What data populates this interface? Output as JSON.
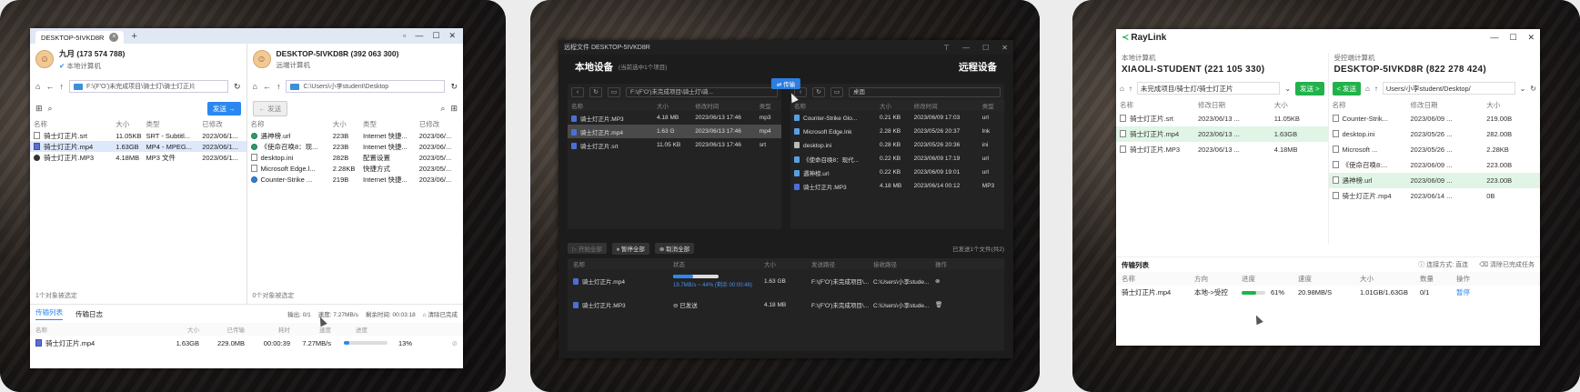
{
  "device1": {
    "tab_title": "DESKTOP-5IVKD8R",
    "tab_close": "×",
    "tab_add": "+",
    "local": {
      "name": "九月 (173 574 788)",
      "sub": "本地计算机",
      "path": "F:\\(F'O')未完成项目\\骑士灯\\骑士灯正片",
      "send_label": "发送",
      "columns": [
        "名称",
        "大小",
        "类型",
        "已修改"
      ],
      "rows": [
        [
          "骑士灯正片.srt",
          "11.05KB",
          "SRT - Subtitl...",
          "2023/06/1..."
        ],
        [
          "骑士灯正片.mp4",
          "1.63GB",
          "MP4 - MPEG...",
          "2023/06/1..."
        ],
        [
          "骑士灯正片.MP3",
          "4.18MB",
          "MP3 文件",
          "2023/06/1..."
        ]
      ],
      "selected_count": "1个对象被选定"
    },
    "remote": {
      "name": "DESKTOP-5IVKD8R (392 063 300)",
      "sub": "远端计算机",
      "path": "C:\\Users\\小李student\\Desktop",
      "send_label": "发送",
      "columns": [
        "名称",
        "大小",
        "类型",
        "已修改"
      ],
      "rows": [
        [
          "遇神榜.url",
          "223B",
          "Internet 快捷...",
          "2023/06/..."
        ],
        [
          "《使命召唤8：现...",
          "223B",
          "Internet 快捷...",
          "2023/06/..."
        ],
        [
          "desktop.ini",
          "282B",
          "配置设置",
          "2023/05/..."
        ],
        [
          "Microsoft Edge.l...",
          "2.28KB",
          "快捷方式",
          "2023/05/..."
        ],
        [
          "Counter-Strike ...",
          "219B",
          "Internet 快捷...",
          "2023/06/..."
        ]
      ],
      "selected_count": "0个对象被选定"
    },
    "transfer": {
      "tab_list": "传输列表",
      "tab_log": "传输日志",
      "stat_inout": "输出: 0/1",
      "stat_speed": "速度: 7.27MB/s",
      "stat_left": "剩余时间: 00:03:18",
      "clear_label": "清除已完成",
      "columns": [
        "名称",
        "大小",
        "已传输",
        "耗时",
        "速度",
        "进度"
      ],
      "row": {
        "name": "骑士灯正片.mp4",
        "size": "1.63GB",
        "done": "229.0MB",
        "time": "00:00:39",
        "speed": "7.27MB/s",
        "progress_text": "13%",
        "progress": 0.13
      }
    }
  },
  "device2": {
    "title": "远程文件 DESKTOP-5IVKD8R",
    "local_label": "本地设备",
    "local_hint": "(当前选中1个项目)",
    "remote_label": "远程设备",
    "local_path": "F:\\(F'O')未完成项目\\骑士灯\\骑...",
    "remote_path": "桌面",
    "send_label": "⇄ 传输",
    "local_columns": [
      "名称",
      "大小",
      "修改时间",
      "类型"
    ],
    "local_rows": [
      [
        "骑士灯正片.MP3",
        "4.18 MB",
        "2023/06/13 17:46",
        "mp3"
      ],
      [
        "骑士灯正片.mp4",
        "1.63 G",
        "2023/06/13 17:46",
        "mp4"
      ],
      [
        "骑士灯正片.srt",
        "11.05 KB",
        "2023/06/13 17:46",
        "srt"
      ]
    ],
    "remote_columns": [
      "名称",
      "大小",
      "修改时间",
      "类型"
    ],
    "remote_rows": [
      [
        "Counter-Strike Glo...",
        "0.21 KB",
        "2023/06/09 17:03",
        "url"
      ],
      [
        "Microsoft Edge.lnk",
        "2.28 KB",
        "2023/05/26 20:37",
        "lnk"
      ],
      [
        "desktop.ini",
        "0.28 KB",
        "2023/05/26 20:36",
        "ini"
      ],
      [
        "《使命召唤8：现代...",
        "0.22 KB",
        "2023/06/09 17:19",
        "url"
      ],
      [
        "遇神榜.url",
        "0.22 KB",
        "2023/06/09 19:01",
        "url"
      ],
      [
        "骑士灯正片.MP3",
        "4.18 MB",
        "2023/06/14 00:12",
        "MP3"
      ]
    ],
    "btn_start_all": "开始全部",
    "btn_pause_all": "暂停全部",
    "btn_cancel_all": "取消全部",
    "done_count": "已发送1个文件(共2)",
    "xfer_columns": [
      "名称",
      "状态",
      "大小",
      "发送路径",
      "接收路径",
      "操作"
    ],
    "xfer_rows": [
      {
        "name": "骑士灯正片.mp4",
        "status": "19.7MB/s ~ 44% (剩余 00:00:48)",
        "progress": 0.44,
        "size": "1.63 GB",
        "src": "F:\\(F'O')未完成项目\\...",
        "dst": "C:\\Users\\小李stude..."
      },
      {
        "name": "骑士灯正片.MP3",
        "status": "已发送",
        "progress": 1,
        "size": "4.18 MB",
        "src": "F:\\(F'O')未完成项目\\...",
        "dst": "C:\\Users\\小李stude..."
      }
    ]
  },
  "device3": {
    "logo": "RayLink",
    "local_label": "本地计算机",
    "local_name": "XIAOLI-STUDENT (221 105 330)",
    "remote_label": "受控端计算机",
    "remote_name": "DESKTOP-5IVKD8R (822 278 424)",
    "local_path": "未完成项目/骑士灯/骑士灯正片",
    "remote_path": "Users/小李student/Desktop/",
    "send_right": "发送 >",
    "send_left": "< 发送",
    "local_columns": [
      "名称",
      "修改日期",
      "大小"
    ],
    "local_rows": [
      [
        "骑士灯正片.srt",
        "2023/06/13 ...",
        "11.05KB"
      ],
      [
        "骑士灯正片.mp4",
        "2023/06/13 ...",
        "1.63GB"
      ],
      [
        "骑士灯正片.MP3",
        "2023/06/13 ...",
        "4.18MB"
      ]
    ],
    "remote_columns": [
      "名称",
      "修改日期",
      "大小"
    ],
    "remote_rows": [
      [
        "Counter-Strik...",
        "2023/06/09 ...",
        "219.00B"
      ],
      [
        "desktop.ini",
        "2023/05/26 ...",
        "282.00B"
      ],
      [
        "Microsoft ...",
        "2023/05/26 ...",
        "2.28KB"
      ],
      [
        "《使命召唤8:...",
        "2023/06/09 ...",
        "223.00B"
      ],
      [
        "遇神榜.url",
        "2023/06/09 ...",
        "223.00B"
      ],
      [
        "骑士灯正片.mp4",
        "2023/06/14 ...",
        "0B"
      ]
    ],
    "xfer_title": "传输列表",
    "conn_mode": "连接方式: 直连",
    "clear_done": "清除已完成任务",
    "xfer_columns": [
      "名称",
      "方向",
      "进度",
      "速度",
      "大小",
      "数量",
      "操作"
    ],
    "xfer_row": {
      "name": "骑士灯正片.mp4",
      "dir": "本地->受控",
      "progress_text": "61%",
      "progress": 0.61,
      "speed": "20.98MB/S",
      "size": "1.01GB/1.63GB",
      "count": "0/1",
      "action": "暂停"
    }
  }
}
